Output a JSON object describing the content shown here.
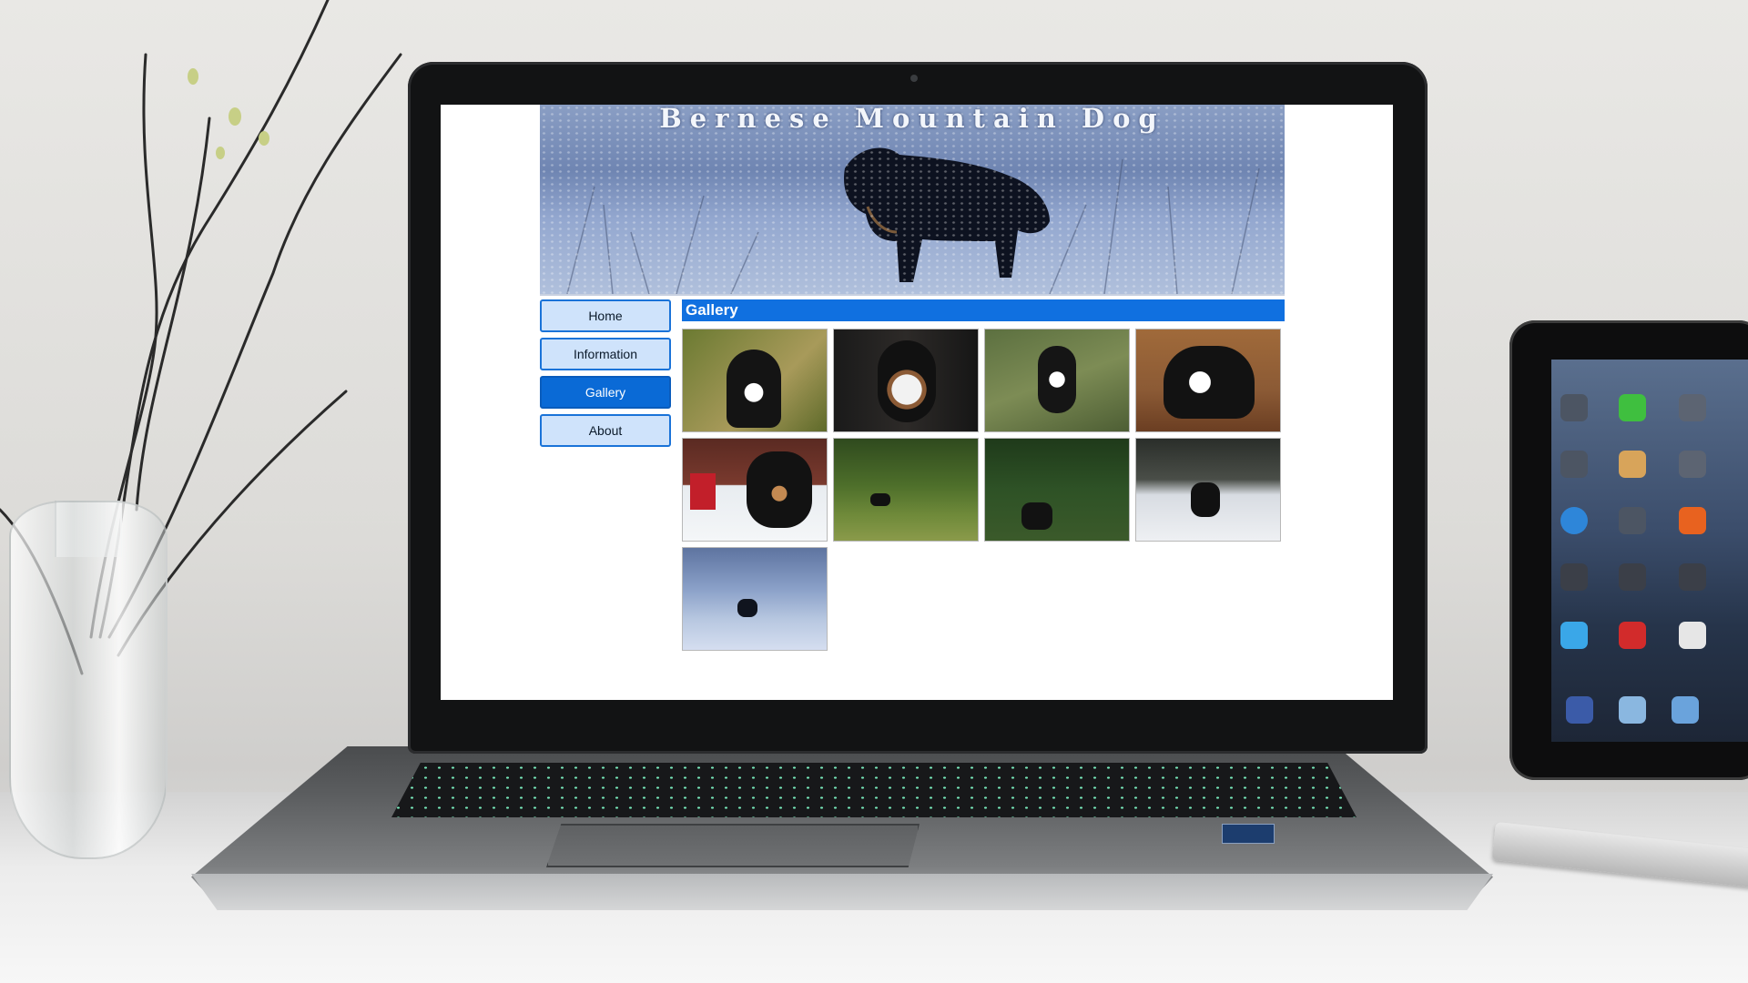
{
  "website": {
    "banner_title": "Bernese Mountain Dog",
    "nav": [
      "Home",
      "Information",
      "Gallery",
      "About"
    ],
    "active_nav": "Gallery",
    "section_heading": "Gallery",
    "gallery_count": 9
  },
  "colors": {
    "accent": "#1070e0",
    "nav_inactive": "#cfe3fb",
    "nav_active": "#0a6ad6"
  }
}
